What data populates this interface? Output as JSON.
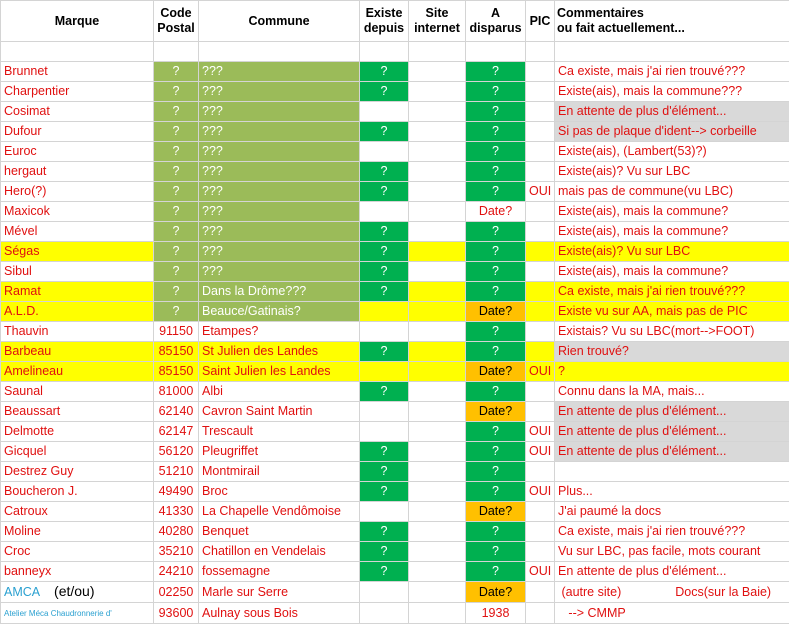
{
  "headers": {
    "marque": "Marque",
    "code_postal_1": "Code",
    "code_postal_2": "Postal",
    "commune": "Commune",
    "existe_1": "Existe",
    "existe_2": "depuis",
    "site_1": "Site",
    "site_2": "internet",
    "a_disparu_1": "A",
    "a_disparu_2": "disparus",
    "pic": "PIC",
    "comm_1": "Commentaires",
    "comm_2": "ou fait actuellement..."
  },
  "rows": [
    {
      "marque": "Brunnet",
      "cp": "?",
      "commune": "???",
      "existe": "?",
      "disparu": "?",
      "pic": "",
      "comm": "Ca existe, mais j'ai rien trouvé???",
      "rowbg": "",
      "cpbg": "olive",
      "combg": "olive",
      "exbg": "green",
      "disbg": "green",
      "commbg": ""
    },
    {
      "marque": "Charpentier",
      "cp": "?",
      "commune": "???",
      "existe": "?",
      "disparu": "?",
      "pic": "",
      "comm": "Existe(ais), mais la commune???",
      "rowbg": "",
      "cpbg": "olive",
      "combg": "olive",
      "exbg": "green",
      "disbg": "green",
      "commbg": ""
    },
    {
      "marque": "Cosimat",
      "cp": "?",
      "commune": "???",
      "existe": "",
      "disparu": "?",
      "pic": "",
      "comm": "En attente de plus d'élément...",
      "rowbg": "",
      "cpbg": "olive",
      "combg": "olive",
      "exbg": "",
      "disbg": "green",
      "commbg": "gray"
    },
    {
      "marque": "Dufour",
      "cp": "?",
      "commune": "???",
      "existe": "?",
      "disparu": "?",
      "pic": "",
      "comm": "Si pas de plaque d'ident--> corbeille",
      "rowbg": "",
      "cpbg": "olive",
      "combg": "olive",
      "exbg": "green",
      "disbg": "green",
      "commbg": "gray"
    },
    {
      "marque": "Euroc",
      "cp": "?",
      "commune": "???",
      "existe": "",
      "disparu": "?",
      "pic": "",
      "comm": "Existe(ais), (Lambert(53)?)",
      "rowbg": "",
      "cpbg": "olive",
      "combg": "olive",
      "exbg": "",
      "disbg": "green",
      "commbg": ""
    },
    {
      "marque": "hergaut",
      "cp": "?",
      "commune": "???",
      "existe": "?",
      "disparu": "?",
      "pic": "",
      "comm": "Existe(ais)? Vu sur LBC",
      "rowbg": "",
      "cpbg": "olive",
      "combg": "olive",
      "exbg": "green",
      "disbg": "green",
      "commbg": ""
    },
    {
      "marque": "Hero(?)",
      "cp": "?",
      "commune": "???",
      "existe": "?",
      "disparu": "?",
      "pic": "OUI",
      "comm": "mais pas de commune(vu LBC)",
      "rowbg": "",
      "cpbg": "olive",
      "combg": "olive",
      "exbg": "green",
      "disbg": "green",
      "commbg": ""
    },
    {
      "marque": "Maxicok",
      "cp": "?",
      "commune": "???",
      "existe": "",
      "disparu": "Date?",
      "pic": "",
      "comm": "Existe(ais), mais la commune?",
      "rowbg": "",
      "cpbg": "olive",
      "combg": "olive",
      "exbg": "",
      "disbg": "",
      "commbg": ""
    },
    {
      "marque": "Mével",
      "cp": "?",
      "commune": "???",
      "existe": "?",
      "disparu": "?",
      "pic": "",
      "comm": "Existe(ais), mais la commune?",
      "rowbg": "",
      "cpbg": "olive",
      "combg": "olive",
      "exbg": "green",
      "disbg": "green",
      "commbg": ""
    },
    {
      "marque": "Ségas",
      "cp": "?",
      "commune": "???",
      "existe": "?",
      "disparu": "?",
      "pic": "",
      "comm": "Existe(ais)? Vu sur LBC",
      "rowbg": "yellow",
      "cpbg": "olive",
      "combg": "olive",
      "exbg": "green",
      "disbg": "green",
      "commbg": ""
    },
    {
      "marque": "Sibul",
      "cp": "?",
      "commune": "???",
      "existe": "?",
      "disparu": "?",
      "pic": "",
      "comm": "Existe(ais), mais la commune?",
      "rowbg": "",
      "cpbg": "olive",
      "combg": "olive",
      "exbg": "green",
      "disbg": "green",
      "commbg": ""
    },
    {
      "marque": "Ramat",
      "cp": "?",
      "commune": "Dans la Drôme???",
      "existe": "?",
      "disparu": "?",
      "pic": "",
      "comm": "Ca existe, mais j'ai rien trouvé???",
      "rowbg": "yellow",
      "cpbg": "olive",
      "combg": "olive",
      "exbg": "green",
      "disbg": "green",
      "commbg": ""
    },
    {
      "marque": "A.L.D.",
      "cp": "?",
      "commune": "Beauce/Gatinais?",
      "existe": "",
      "disparu": "Date?",
      "pic": "",
      "comm": "Existe vu sur AA, mais pas de PIC",
      "rowbg": "yellow",
      "cpbg": "olive",
      "combg": "olive",
      "exbg": "",
      "disbg": "orange",
      "commbg": ""
    },
    {
      "marque": "Thauvin",
      "cp": "91150",
      "commune": "Etampes?",
      "existe": "",
      "disparu": "?",
      "pic": "",
      "comm": "Existais? Vu su LBC(mort-->FOOT)",
      "rowbg": "",
      "cpbg": "",
      "combg": "",
      "exbg": "",
      "disbg": "green",
      "commbg": ""
    },
    {
      "marque": "Barbeau",
      "cp": "85150",
      "commune": "St Julien des Landes",
      "existe": "?",
      "disparu": "?",
      "pic": "",
      "comm": "Rien trouvé?",
      "rowbg": "yellow",
      "cpbg": "",
      "combg": "",
      "exbg": "green",
      "disbg": "green",
      "commbg": "gray"
    },
    {
      "marque": "Amelineau",
      "cp": "85150",
      "commune": "Saint Julien les Landes",
      "existe": "",
      "disparu": "Date?",
      "pic": "OUI",
      "comm": "?",
      "rowbg": "yellow",
      "cpbg": "",
      "combg": "",
      "exbg": "",
      "disbg": "orange",
      "commbg": ""
    },
    {
      "marque": "Saunal",
      "cp": "81000",
      "commune": "Albi",
      "existe": "?",
      "disparu": "?",
      "pic": "",
      "comm": "Connu dans la MA, mais...",
      "rowbg": "",
      "cpbg": "",
      "combg": "",
      "exbg": "green",
      "disbg": "green",
      "commbg": ""
    },
    {
      "marque": "Beaussart",
      "cp": "62140",
      "commune": "Cavron Saint Martin",
      "existe": "",
      "disparu": "Date?",
      "pic": "",
      "comm": "En attente de plus d'élément...",
      "rowbg": "",
      "cpbg": "",
      "combg": "",
      "exbg": "",
      "disbg": "orange",
      "commbg": "gray"
    },
    {
      "marque": "Delmotte",
      "cp": "62147",
      "commune": "Trescault",
      "existe": "",
      "disparu": "?",
      "pic": "OUI",
      "comm": "En attente de plus d'élément...",
      "rowbg": "",
      "cpbg": "",
      "combg": "",
      "exbg": "",
      "disbg": "green",
      "commbg": "gray"
    },
    {
      "marque": "Gicquel",
      "cp": "56120",
      "commune": "Pleugriffet",
      "existe": "?",
      "disparu": "?",
      "pic": "OUI",
      "comm": "En attente de plus d'élément...",
      "rowbg": "",
      "cpbg": "",
      "combg": "",
      "exbg": "green",
      "disbg": "green",
      "commbg": "gray"
    },
    {
      "marque": "Destrez Guy",
      "cp": "51210",
      "commune": "Montmirail",
      "existe": "?",
      "disparu": "?",
      "pic": "",
      "comm": "",
      "rowbg": "",
      "cpbg": "",
      "combg": "",
      "exbg": "green",
      "disbg": "green",
      "commbg": ""
    },
    {
      "marque": "Boucheron J.",
      "cp": "49490",
      "commune": "Broc",
      "existe": "?",
      "disparu": "?",
      "pic": "OUI",
      "comm": "Plus...",
      "rowbg": "",
      "cpbg": "",
      "combg": "",
      "exbg": "green",
      "disbg": "green",
      "commbg": ""
    },
    {
      "marque": "Catroux",
      "cp": "41330",
      "commune": "La Chapelle Vendômoise",
      "existe": "",
      "disparu": "Date?",
      "pic": "",
      "comm": "J'ai paumé la docs",
      "rowbg": "",
      "cpbg": "",
      "combg": "",
      "exbg": "",
      "disbg": "orange",
      "commbg": ""
    },
    {
      "marque": "Moline",
      "cp": "40280",
      "commune": "Benquet",
      "existe": "?",
      "disparu": "?",
      "pic": "",
      "comm": "Ca existe, mais j'ai rien trouvé???",
      "rowbg": "",
      "cpbg": "",
      "combg": "",
      "exbg": "green",
      "disbg": "green",
      "commbg": ""
    },
    {
      "marque": "Croc",
      "cp": "35210",
      "commune": "Chatillon en Vendelais",
      "existe": "?",
      "disparu": "?",
      "pic": "",
      "comm": "Vu sur LBC, pas facile, mots courant",
      "rowbg": "",
      "cpbg": "",
      "combg": "",
      "exbg": "green",
      "disbg": "green",
      "commbg": ""
    },
    {
      "marque": "banneyx",
      "cp": "24210",
      "commune": "fossemagne",
      "existe": "?",
      "disparu": "?",
      "pic": "OUI",
      "comm": "En attente de plus d'élément...",
      "rowbg": "",
      "cpbg": "",
      "combg": "",
      "exbg": "green",
      "disbg": "green",
      "commbg": ""
    }
  ],
  "amca": {
    "marque": "AMCA",
    "extra": "(et/ou)",
    "cp": "02250",
    "commune": "Marle sur Serre",
    "disparu": "Date?",
    "comm": "(autre site)",
    "comm2": "Docs(sur la Baie)"
  },
  "atelier": {
    "marque_1": "Atelier ",
    "marque_2": "Méca ",
    "marque_3": "Chaudronnerie d'",
    "cp": "93600",
    "commune": "Aulnay sous Bois",
    "disparu": "1938",
    "comm": "--> CMMP"
  }
}
